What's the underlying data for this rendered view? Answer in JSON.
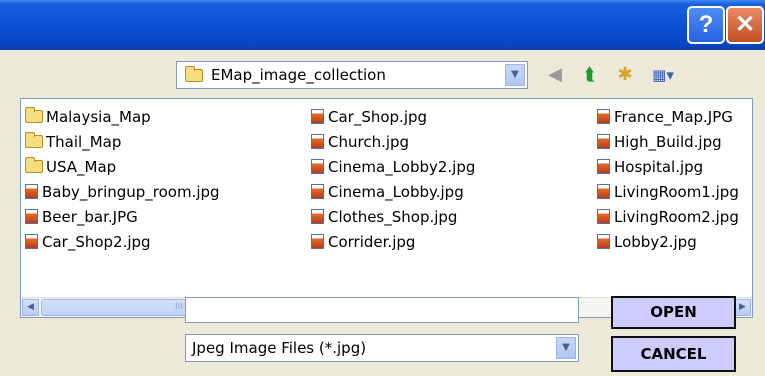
{
  "titlebar": {
    "help_label": "?",
    "close_label": "✕"
  },
  "look_in": {
    "folder_name": "EMap_image_collection",
    "dropdown_icon": "chevron-down-icon"
  },
  "toolbar": {
    "back_icon": "◀",
    "up_icon": "⮬",
    "new_folder_icon": "✱",
    "view_icon": "▦▾"
  },
  "files": {
    "column1": [
      {
        "name": "Malaysia_Map",
        "type": "folder"
      },
      {
        "name": "Thail_Map",
        "type": "folder"
      },
      {
        "name": "USA_Map",
        "type": "folder"
      },
      {
        "name": "Baby_bringup_room.jpg",
        "type": "jpg"
      },
      {
        "name": "Beer_bar.JPG",
        "type": "jpg"
      },
      {
        "name": "Car_Shop2.jpg",
        "type": "jpg"
      }
    ],
    "column2": [
      {
        "name": "Car_Shop.jpg",
        "type": "jpg"
      },
      {
        "name": "Church.jpg",
        "type": "jpg"
      },
      {
        "name": "Cinema_Lobby2.jpg",
        "type": "jpg"
      },
      {
        "name": "Cinema_Lobby.jpg",
        "type": "jpg"
      },
      {
        "name": "Clothes_Shop.jpg",
        "type": "jpg"
      },
      {
        "name": "Corrider.jpg",
        "type": "jpg"
      }
    ],
    "column3": [
      {
        "name": "France_Map.JPG",
        "type": "jpg"
      },
      {
        "name": "High_Build.jpg",
        "type": "jpg"
      },
      {
        "name": "Hospital.jpg",
        "type": "jpg"
      },
      {
        "name": "LivingRoom1.jpg",
        "type": "jpg"
      },
      {
        "name": "LivingRoom2.jpg",
        "type": "jpg"
      },
      {
        "name": "Lobby2.jpg",
        "type": "jpg"
      }
    ]
  },
  "scrollbar": {
    "left_arrow": "◀",
    "right_arrow": "▶",
    "thumb_grip": "III"
  },
  "filename": {
    "value": ""
  },
  "filetype": {
    "selected": "Jpeg Image Files (*.jpg)"
  },
  "buttons": {
    "open": "OPEN",
    "cancel": "CANCEL"
  },
  "colors": {
    "titlebar": "#0a4fd6",
    "button_bg": "#ccccff",
    "dialog_bg": "#ece9d8"
  }
}
